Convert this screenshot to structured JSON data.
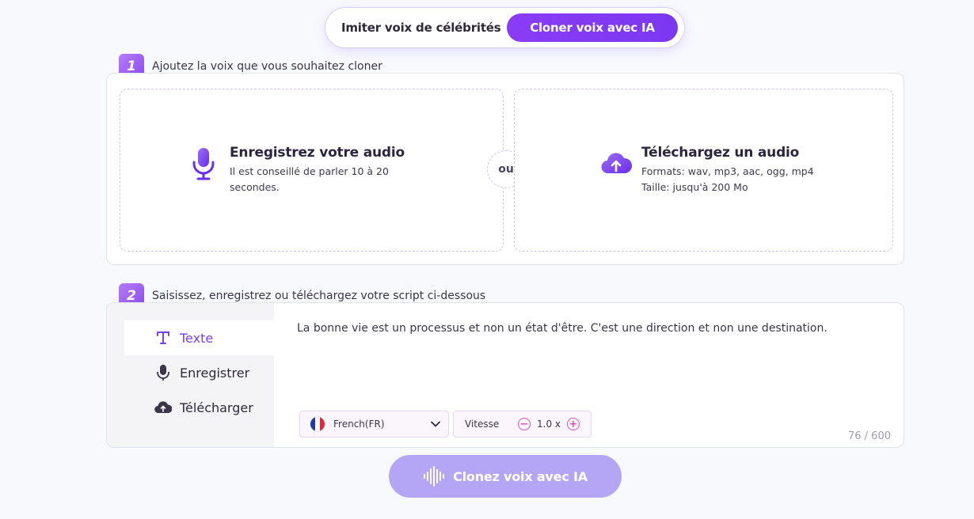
{
  "toggle": {
    "option_a": "Imiter voix de célébrités",
    "option_b": "Cloner voix avec IA"
  },
  "step1": {
    "number": "1",
    "label": "Ajoutez la voix que vous souhaitez cloner",
    "record": {
      "title": "Enregistrez votre audio",
      "subtitle": "Il est conseillé de parler 10 à 20 secondes.",
      "icon": "microphone-icon"
    },
    "separator": "ou",
    "upload": {
      "title": "Téléchargez un audio",
      "formats": "Formats: wav, mp3, aac, ogg, mp4",
      "size": "Taille: jusqu'à 200 Mo",
      "icon": "cloud-upload-icon"
    }
  },
  "step2": {
    "number": "2",
    "label": "Saisissez, enregistrez ou téléchargez votre script ci-dessous",
    "tabs": [
      {
        "label": "Texte",
        "icon": "text-icon",
        "active": true
      },
      {
        "label": "Enregistrer",
        "icon": "microphone-icon",
        "active": false
      },
      {
        "label": "Télécharger",
        "icon": "cloud-upload-icon",
        "active": false
      }
    ],
    "script": "La bonne vie est un processus et non un état d'être. C'est une direction et non une destination.",
    "language": "French(FR)",
    "speed_label": "Vitesse",
    "speed_value": "1.0 x",
    "counter": "76 / 600"
  },
  "cta": {
    "label": "Clonez voix avec IA"
  },
  "colors": {
    "accent": "#7b3ff0",
    "cta_disabled": "#b4a6f4",
    "speed_control": "#e04fb5"
  }
}
